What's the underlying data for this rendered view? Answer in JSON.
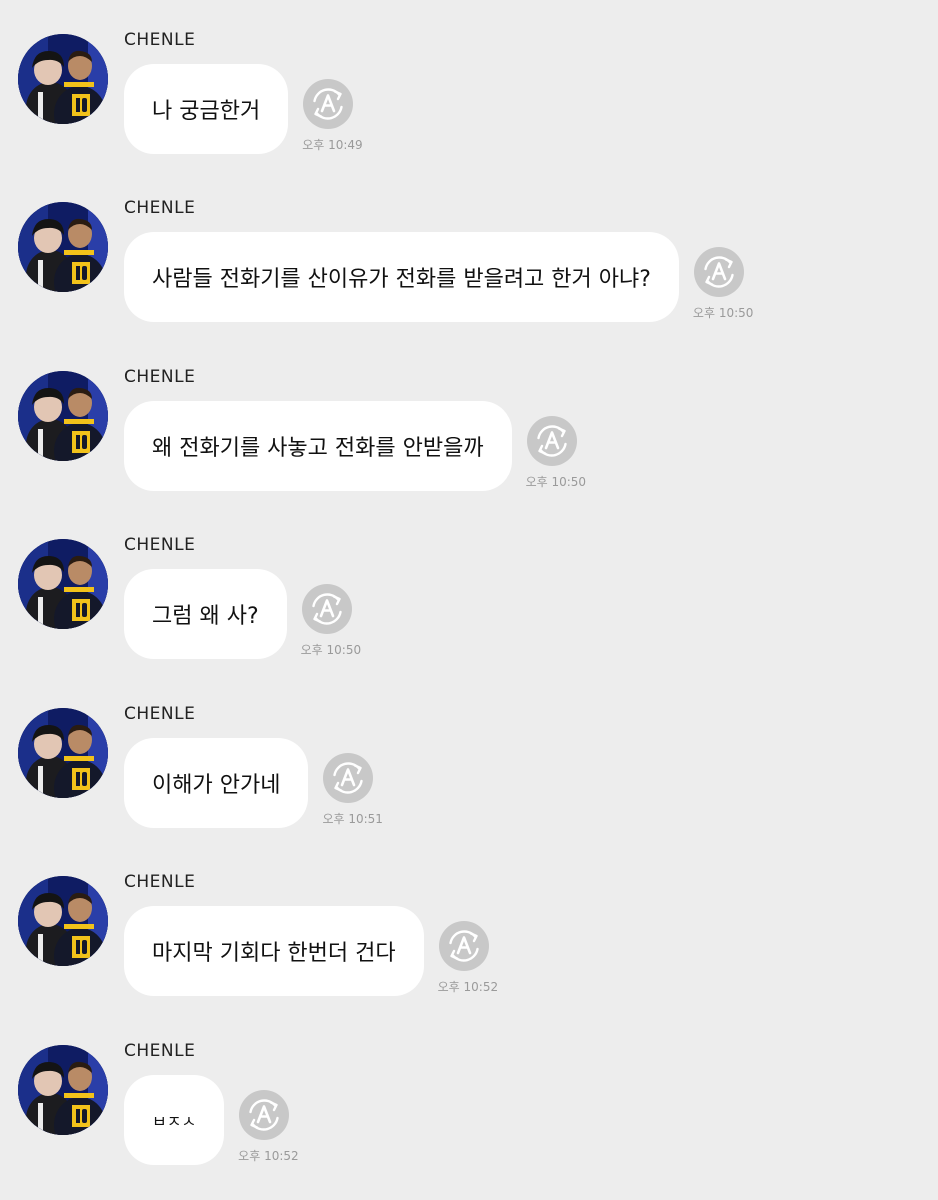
{
  "messages": [
    {
      "sender": "CHENLE",
      "text": "나 궁금한거",
      "time": "오후 10:49"
    },
    {
      "sender": "CHENLE",
      "text": "사람들 전화기를 산이유가 전화를 받을려고 한거 아냐?",
      "time": "오후 10:50"
    },
    {
      "sender": "CHENLE",
      "text": "왜 전화기를 사놓고 전화를 안받을까",
      "time": "오후 10:50"
    },
    {
      "sender": "CHENLE",
      "text": "그럼 왜 사?",
      "time": "오후 10:50"
    },
    {
      "sender": "CHENLE",
      "text": "이해가 안가네",
      "time": "오후 10:51"
    },
    {
      "sender": "CHENLE",
      "text": "마지막 기회다 한번더 건다",
      "time": "오후 10:52"
    },
    {
      "sender": "CHENLE",
      "text": "ㅂㅈㅅ",
      "time": "오후 10:52"
    }
  ],
  "icons": {
    "translate": "translate-icon",
    "avatar": "profile-photo"
  },
  "colors": {
    "background": "#ededed",
    "bubble": "#ffffff",
    "icon": "#c8c8c8",
    "time": "#9a9a9a"
  }
}
